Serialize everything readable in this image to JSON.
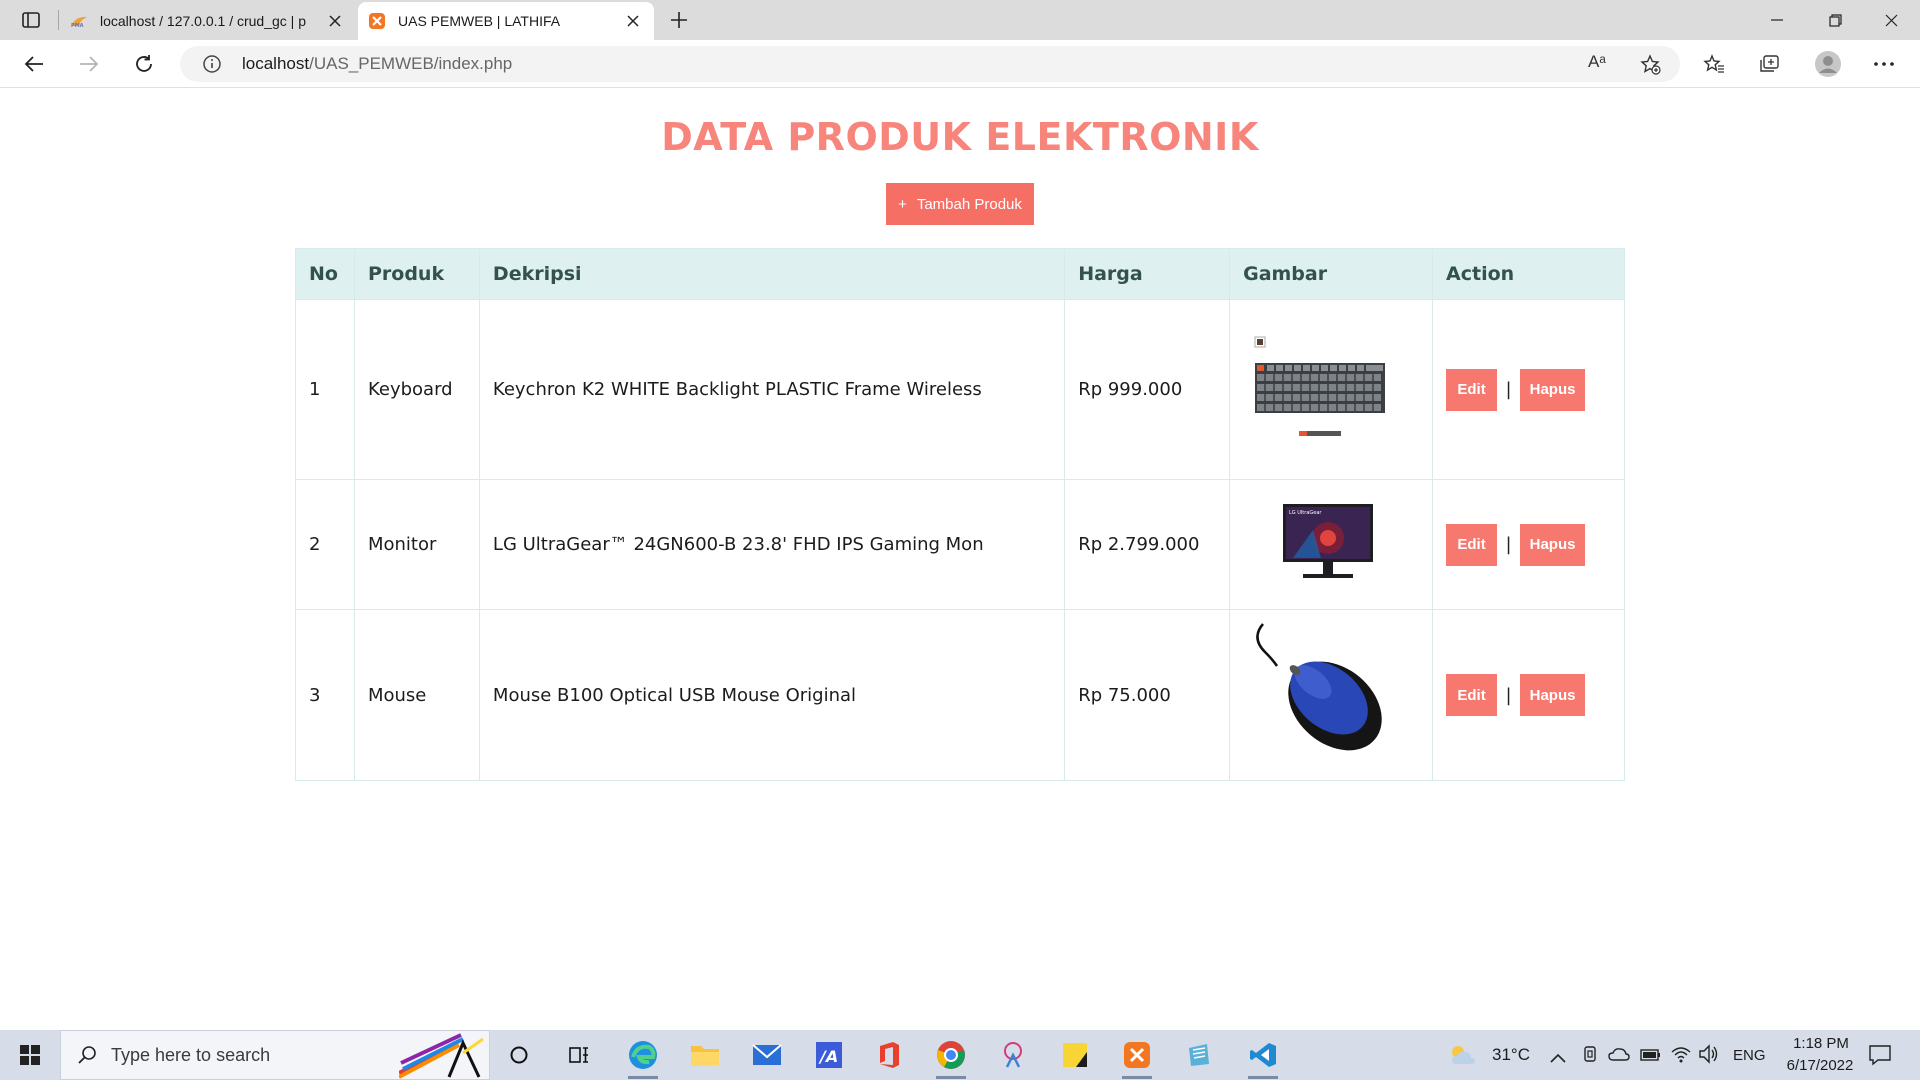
{
  "browser": {
    "tabs": [
      {
        "title": "localhost / 127.0.0.1 / crud_gc | p"
      },
      {
        "title": "UAS PEMWEB | LATHIFA"
      }
    ],
    "url_host": "localhost",
    "url_path": "/UAS_PEMWEB/index.php",
    "read_aloud_label": "Aᵃ"
  },
  "page": {
    "title": "DATA PRODUK ELEKTRONIK",
    "add_button": "Tambah Produk",
    "add_icon": "+",
    "columns": [
      "No",
      "Produk",
      "Dekripsi",
      "Harga",
      "Gambar",
      "Action"
    ],
    "rows": [
      {
        "no": "1",
        "produk": "Keyboard",
        "deskripsi": "Keychron K2 WHITE Backlight PLASTIC Frame Wireless",
        "harga": "Rp 999.000",
        "image": "keyboard-image",
        "edit": "Edit",
        "hapus": "Hapus",
        "sep": "|"
      },
      {
        "no": "2",
        "produk": "Monitor",
        "deskripsi": "LG UltraGear™ 24GN600-B 23.8' FHD IPS Gaming Mon",
        "harga": "Rp 2.799.000",
        "image": "monitor-image",
        "edit": "Edit",
        "hapus": "Hapus",
        "sep": "|"
      },
      {
        "no": "3",
        "produk": "Mouse",
        "deskripsi": "Mouse B100 Optical USB Mouse Original",
        "harga": "Rp 75.000",
        "image": "mouse-image",
        "edit": "Edit",
        "hapus": "Hapus",
        "sep": "|"
      }
    ],
    "monitor_brand_text": "LG UltraGear",
    "colors": {
      "accent": "#f56f65",
      "title": "#f7857b",
      "header_bg": "#def0ef"
    }
  },
  "taskbar": {
    "search_placeholder": "Type here to search",
    "temperature": "31°C",
    "language": "ENG",
    "time": "1:18 PM",
    "date": "6/17/2022"
  }
}
